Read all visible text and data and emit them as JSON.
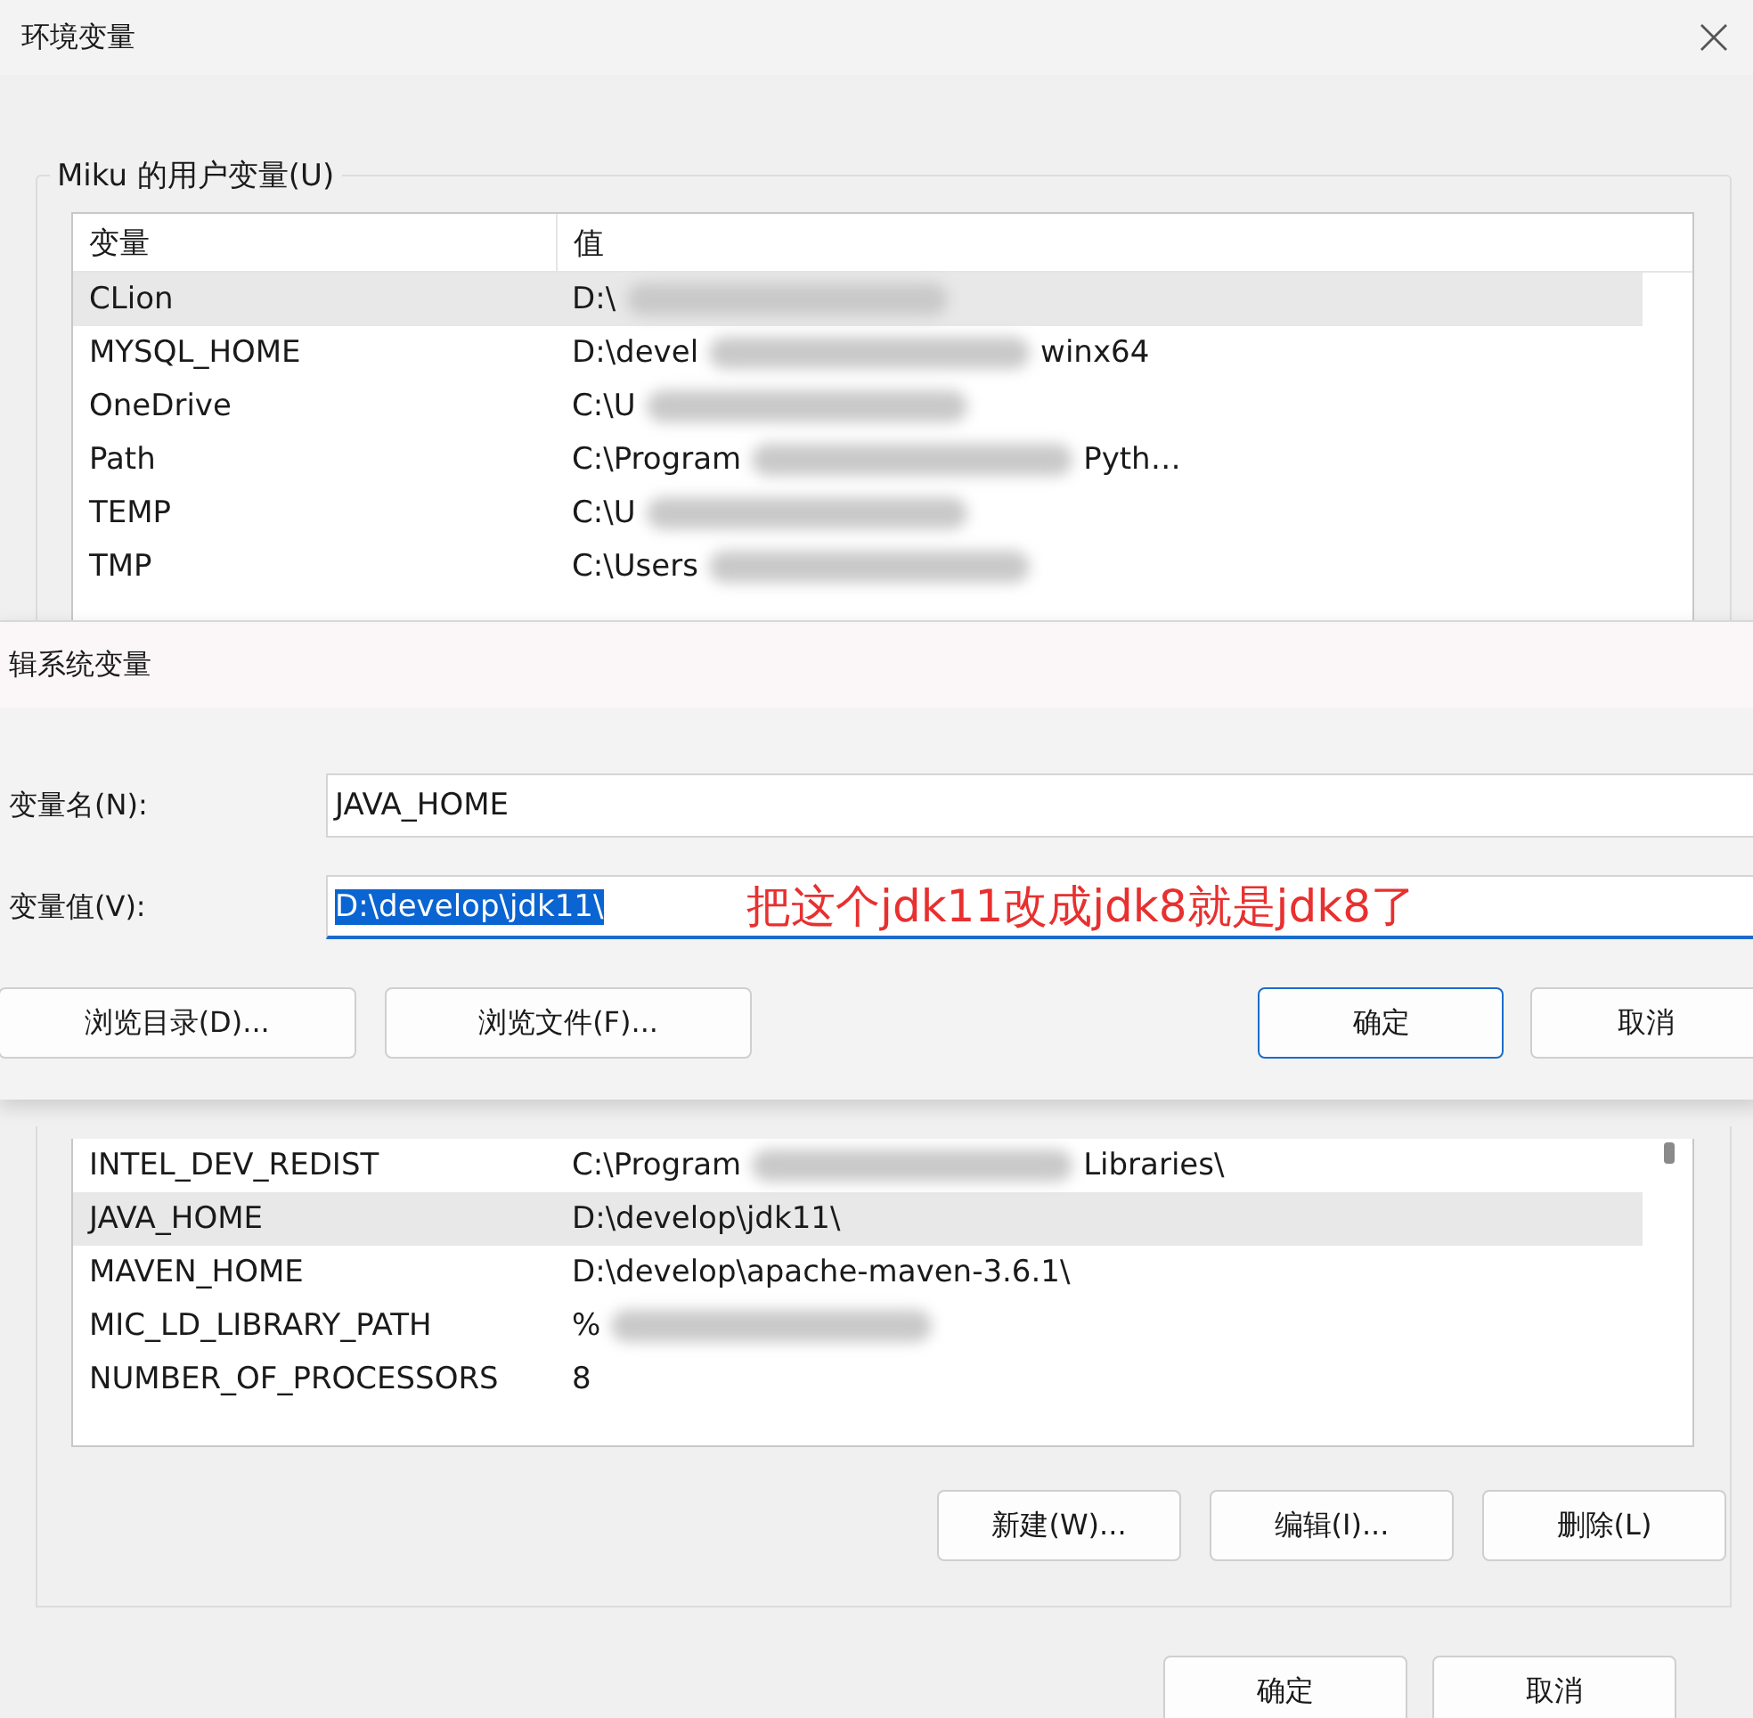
{
  "window": {
    "title": "环境变量"
  },
  "user_variables": {
    "label": "Miku 的用户变量(U)",
    "columns": [
      "变量",
      "值"
    ],
    "rows": [
      {
        "name": "CLion",
        "value": "D:\\",
        "redacted": true,
        "selected": true
      },
      {
        "name": "MYSQL_HOME",
        "value": "D:\\devel",
        "redacted": true,
        "tail": "winx64",
        "selected": false
      },
      {
        "name": "OneDrive",
        "value": "C:\\U",
        "redacted": true,
        "selected": false
      },
      {
        "name": "Path",
        "value": "C:\\Program",
        "redacted": true,
        "tail": "Pyth…",
        "selected": false
      },
      {
        "name": "TEMP",
        "value": "C:\\U",
        "redacted": true,
        "selected": false
      },
      {
        "name": "TMP",
        "value": "C:\\Users",
        "redacted": true,
        "selected": false
      }
    ]
  },
  "edit_dialog": {
    "title": "辑系统变量",
    "name_label": "变量名(N):",
    "name_value": "JAVA_HOME",
    "value_label": "变量值(V):",
    "value": "D:\\develop\\jdk11\\",
    "value_selected": true,
    "buttons": [
      {
        "label": "浏览目录(D)...",
        "default": false
      },
      {
        "label": "浏览文件(F)...",
        "default": false
      },
      {
        "label": "确定",
        "default": true
      },
      {
        "label": "取消",
        "default": false
      }
    ]
  },
  "annotation": "把这个jdk11改成jdk8就是jdk8了",
  "system_variables": {
    "rows": [
      {
        "name": "INTEL_DEV_REDIST",
        "value": "C:\\Program",
        "redacted": true,
        "tail": "Libraries\\",
        "selected": false
      },
      {
        "name": "JAVA_HOME",
        "value": "D:\\develop\\jdk11\\",
        "redacted": false,
        "selected": true
      },
      {
        "name": "MAVEN_HOME",
        "value": "D:\\develop\\apache-maven-3.6.1\\",
        "redacted": false,
        "selected": false
      },
      {
        "name": "MIC_LD_LIBRARY_PATH",
        "value": "%",
        "redacted": true,
        "selected": false
      },
      {
        "name": "NUMBER_OF_PROCESSORS",
        "value": "8",
        "redacted": false,
        "selected": false
      }
    ],
    "buttons": [
      "新建(W)...",
      "编辑(I)...",
      "删除(L)"
    ]
  },
  "footer_buttons": [
    "确定",
    "取消"
  ]
}
